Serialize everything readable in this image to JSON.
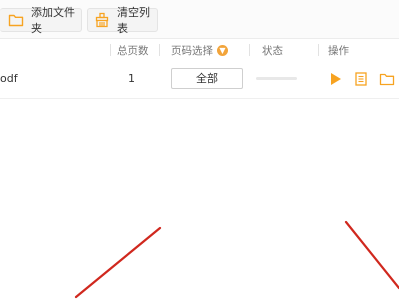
{
  "toolbar": {
    "add_folder_label": "添加文件夹",
    "clear_list_label": "清空列表",
    "accent_color": "#f7a321"
  },
  "table": {
    "columns": {
      "total_pages": "总页数",
      "page_select": "页码选择",
      "status": "状态",
      "actions": "操作"
    },
    "rows": [
      {
        "filename": "odf",
        "total_pages": "1",
        "page_select_value": "全部",
        "progress": 0
      }
    ]
  },
  "icons": {
    "add_folder": "folder-icon",
    "clear_list": "broom-icon",
    "dropdown": "chevron-down-icon",
    "play": "play-icon",
    "document": "document-icon",
    "open_folder": "folder-icon"
  },
  "annotation_color": "#d0281e"
}
